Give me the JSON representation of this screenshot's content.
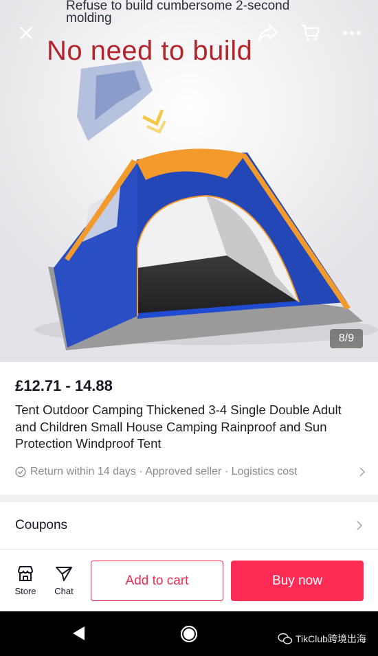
{
  "hero": {
    "caption": "Refuse to build cumbersome 2-second molding",
    "headline": "No need to build",
    "counter": "8/9"
  },
  "top_bar": {
    "close_icon": "close-icon",
    "share_icon": "share-icon",
    "cart_icon": "cart-icon",
    "more_icon": "more-icon"
  },
  "product": {
    "price": "£12.71 - 14.88",
    "title": "Tent Outdoor Camping Thickened 3-4 Single Double Adult and Children Small House Camping Rainproof and Sun Protection Windproof Tent",
    "service_text": "Return within 14 days · Approved seller · Logistics cost"
  },
  "coupons": {
    "label": "Coupons"
  },
  "action_bar": {
    "store_label": "Store",
    "chat_label": "Chat",
    "add_to_cart": "Add to cart",
    "buy_now": "Buy now"
  },
  "watermark": {
    "text": "TikClub跨境出海"
  },
  "colors": {
    "accent": "#fe2c55",
    "tent_blue": "#2447b8",
    "tent_orange": "#f39a2c",
    "headline_red": "#b3252d"
  }
}
